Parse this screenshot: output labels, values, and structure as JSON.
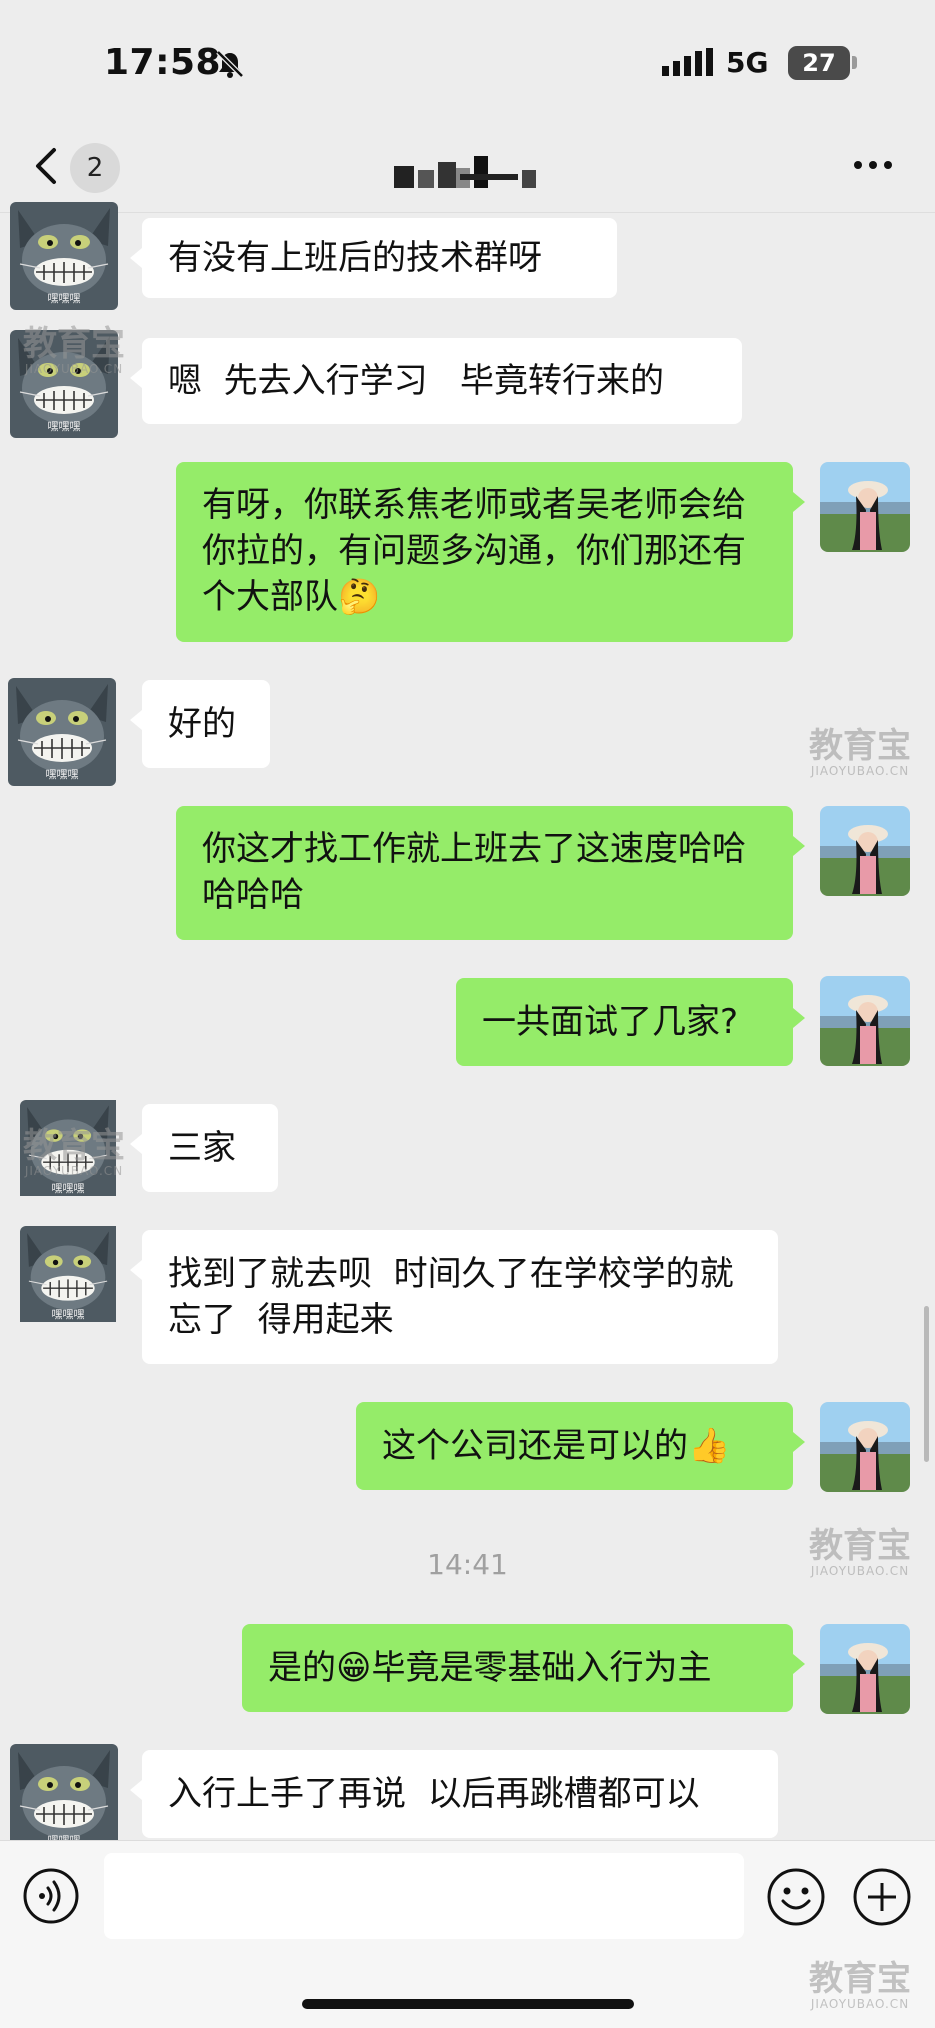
{
  "status_bar": {
    "time": "17:58",
    "network": "5G",
    "battery": "27"
  },
  "header": {
    "unread_count": "2"
  },
  "messages": [
    {
      "side": "in",
      "text": "有没有上班后的技术群呀"
    },
    {
      "side": "in",
      "text": "嗯  先去入行学习   毕竟转行来的"
    },
    {
      "side": "out",
      "text": "有呀，你联系焦老师或者吴老师会给你拉的，有问题多沟通，你们那还有个大部队🤔"
    },
    {
      "side": "in",
      "text": "好的"
    },
    {
      "side": "out",
      "text": "你这才找工作就上班去了这速度哈哈哈哈哈"
    },
    {
      "side": "out",
      "text": "一共面试了几家?"
    },
    {
      "side": "in",
      "text": "三家"
    },
    {
      "side": "in",
      "text": "找到了就去呗  时间久了在学校学的就忘了  得用起来"
    },
    {
      "side": "out",
      "text": "这个公司还是可以的👍"
    },
    {
      "side": "out",
      "text": "是的😁毕竟是零基础入行为主"
    },
    {
      "side": "in",
      "text": "入行上手了再说  以后再跳槽都可以"
    }
  ],
  "timestamp": "14:41",
  "avatar_caption": "嘿嘿嘿",
  "watermark": {
    "brand": "教育宝",
    "domain": "JIAOYUBAO.CN"
  },
  "icons": {
    "back": "chevron-left-icon",
    "more": "ellipsis-icon",
    "voice": "voice-icon",
    "emoji": "emoji-icon",
    "plus": "plus-icon",
    "mute": "bell-slash-icon"
  },
  "colors": {
    "background": "#ededed",
    "outgoing_bubble": "#95ec69",
    "incoming_bubble": "#ffffff"
  }
}
